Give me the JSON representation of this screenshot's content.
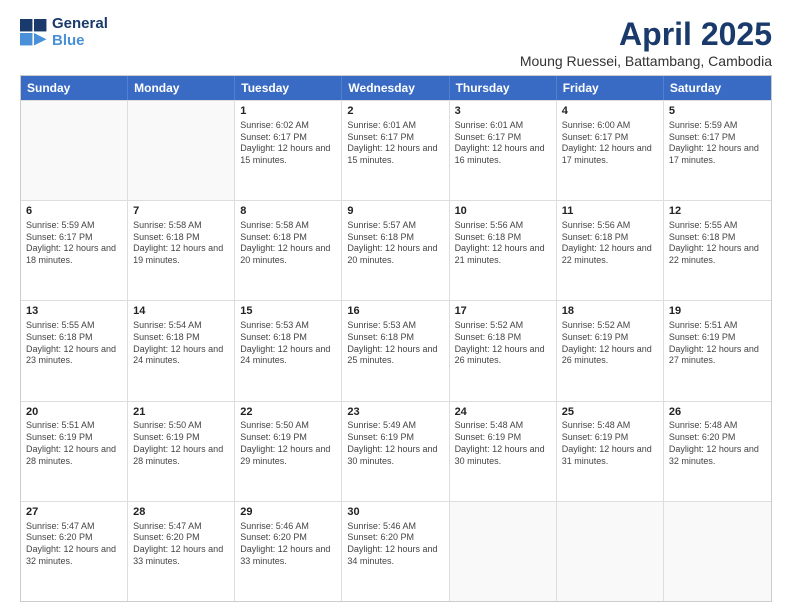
{
  "logo": {
    "line1": "General",
    "line2": "Blue",
    "icon": "▶"
  },
  "title": "April 2025",
  "subtitle": "Moung Ruessei, Battambang, Cambodia",
  "headers": [
    "Sunday",
    "Monday",
    "Tuesday",
    "Wednesday",
    "Thursday",
    "Friday",
    "Saturday"
  ],
  "weeks": [
    [
      {
        "day": "",
        "info": "",
        "empty": true
      },
      {
        "day": "",
        "info": "",
        "empty": true
      },
      {
        "day": "1",
        "info": "Sunrise: 6:02 AM\nSunset: 6:17 PM\nDaylight: 12 hours and 15 minutes."
      },
      {
        "day": "2",
        "info": "Sunrise: 6:01 AM\nSunset: 6:17 PM\nDaylight: 12 hours and 15 minutes."
      },
      {
        "day": "3",
        "info": "Sunrise: 6:01 AM\nSunset: 6:17 PM\nDaylight: 12 hours and 16 minutes."
      },
      {
        "day": "4",
        "info": "Sunrise: 6:00 AM\nSunset: 6:17 PM\nDaylight: 12 hours and 17 minutes."
      },
      {
        "day": "5",
        "info": "Sunrise: 5:59 AM\nSunset: 6:17 PM\nDaylight: 12 hours and 17 minutes."
      }
    ],
    [
      {
        "day": "6",
        "info": "Sunrise: 5:59 AM\nSunset: 6:17 PM\nDaylight: 12 hours and 18 minutes."
      },
      {
        "day": "7",
        "info": "Sunrise: 5:58 AM\nSunset: 6:18 PM\nDaylight: 12 hours and 19 minutes."
      },
      {
        "day": "8",
        "info": "Sunrise: 5:58 AM\nSunset: 6:18 PM\nDaylight: 12 hours and 20 minutes."
      },
      {
        "day": "9",
        "info": "Sunrise: 5:57 AM\nSunset: 6:18 PM\nDaylight: 12 hours and 20 minutes."
      },
      {
        "day": "10",
        "info": "Sunrise: 5:56 AM\nSunset: 6:18 PM\nDaylight: 12 hours and 21 minutes."
      },
      {
        "day": "11",
        "info": "Sunrise: 5:56 AM\nSunset: 6:18 PM\nDaylight: 12 hours and 22 minutes."
      },
      {
        "day": "12",
        "info": "Sunrise: 5:55 AM\nSunset: 6:18 PM\nDaylight: 12 hours and 22 minutes."
      }
    ],
    [
      {
        "day": "13",
        "info": "Sunrise: 5:55 AM\nSunset: 6:18 PM\nDaylight: 12 hours and 23 minutes."
      },
      {
        "day": "14",
        "info": "Sunrise: 5:54 AM\nSunset: 6:18 PM\nDaylight: 12 hours and 24 minutes."
      },
      {
        "day": "15",
        "info": "Sunrise: 5:53 AM\nSunset: 6:18 PM\nDaylight: 12 hours and 24 minutes."
      },
      {
        "day": "16",
        "info": "Sunrise: 5:53 AM\nSunset: 6:18 PM\nDaylight: 12 hours and 25 minutes."
      },
      {
        "day": "17",
        "info": "Sunrise: 5:52 AM\nSunset: 6:18 PM\nDaylight: 12 hours and 26 minutes."
      },
      {
        "day": "18",
        "info": "Sunrise: 5:52 AM\nSunset: 6:19 PM\nDaylight: 12 hours and 26 minutes."
      },
      {
        "day": "19",
        "info": "Sunrise: 5:51 AM\nSunset: 6:19 PM\nDaylight: 12 hours and 27 minutes."
      }
    ],
    [
      {
        "day": "20",
        "info": "Sunrise: 5:51 AM\nSunset: 6:19 PM\nDaylight: 12 hours and 28 minutes."
      },
      {
        "day": "21",
        "info": "Sunrise: 5:50 AM\nSunset: 6:19 PM\nDaylight: 12 hours and 28 minutes."
      },
      {
        "day": "22",
        "info": "Sunrise: 5:50 AM\nSunset: 6:19 PM\nDaylight: 12 hours and 29 minutes."
      },
      {
        "day": "23",
        "info": "Sunrise: 5:49 AM\nSunset: 6:19 PM\nDaylight: 12 hours and 30 minutes."
      },
      {
        "day": "24",
        "info": "Sunrise: 5:48 AM\nSunset: 6:19 PM\nDaylight: 12 hours and 30 minutes."
      },
      {
        "day": "25",
        "info": "Sunrise: 5:48 AM\nSunset: 6:19 PM\nDaylight: 12 hours and 31 minutes."
      },
      {
        "day": "26",
        "info": "Sunrise: 5:48 AM\nSunset: 6:20 PM\nDaylight: 12 hours and 32 minutes."
      }
    ],
    [
      {
        "day": "27",
        "info": "Sunrise: 5:47 AM\nSunset: 6:20 PM\nDaylight: 12 hours and 32 minutes."
      },
      {
        "day": "28",
        "info": "Sunrise: 5:47 AM\nSunset: 6:20 PM\nDaylight: 12 hours and 33 minutes."
      },
      {
        "day": "29",
        "info": "Sunrise: 5:46 AM\nSunset: 6:20 PM\nDaylight: 12 hours and 33 minutes."
      },
      {
        "day": "30",
        "info": "Sunrise: 5:46 AM\nSunset: 6:20 PM\nDaylight: 12 hours and 34 minutes."
      },
      {
        "day": "",
        "info": "",
        "empty": true
      },
      {
        "day": "",
        "info": "",
        "empty": true
      },
      {
        "day": "",
        "info": "",
        "empty": true
      }
    ]
  ]
}
